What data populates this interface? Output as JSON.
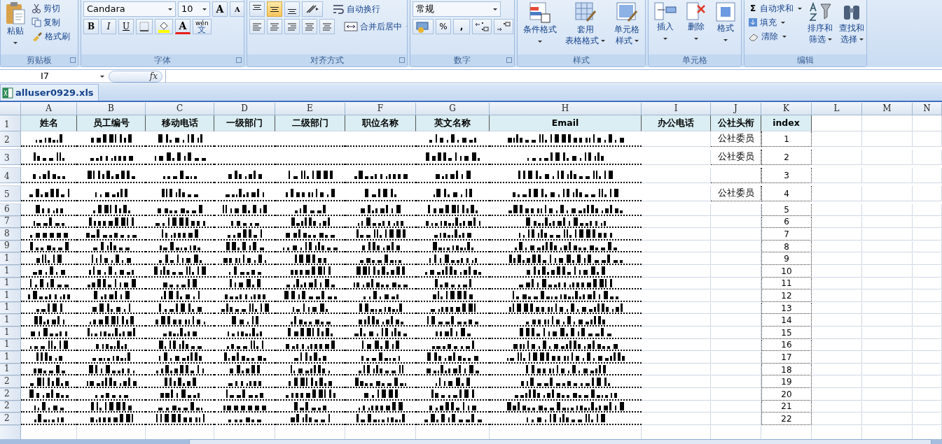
{
  "ribbon": {
    "groups": [
      {
        "kind": "clipboard",
        "label": "剪贴板",
        "big": "粘贴",
        "small": [
          "剪切",
          "复制",
          "格式刷"
        ]
      },
      {
        "kind": "font",
        "label": "字体",
        "font": "Candara",
        "size": "10",
        "grow": "A",
        "shrink": "A",
        "styles": [
          "B",
          "I",
          "U"
        ],
        "color_letter": "A",
        "phonetic_top": "wén",
        "phonetic_char": "文"
      },
      {
        "kind": "align",
        "label": "对齐方式",
        "valign": [
          {
            "selected": false
          },
          {
            "selected": true
          },
          {
            "selected": false
          }
        ],
        "wrap": "自动换行",
        "merge": "合并后居中"
      },
      {
        "kind": "number",
        "label": "数字",
        "format": "常规",
        "percent": "%",
        "comma": ","
      },
      {
        "kind": "large",
        "label": "样式",
        "buttons": [
          {
            "lines": [
              "条件格式"
            ]
          },
          {
            "lines": [
              "套用",
              "表格格式"
            ]
          },
          {
            "lines": [
              "单元格",
              "样式"
            ]
          }
        ]
      },
      {
        "kind": "large",
        "label": "单元格",
        "buttons": [
          {
            "lines": [
              "插入"
            ]
          },
          {
            "lines": [
              "删除"
            ]
          },
          {
            "lines": [
              "格式"
            ]
          }
        ]
      },
      {
        "kind": "editing",
        "label": "编辑",
        "sum_icon": "Σ",
        "small": [
          "自动求和",
          "填充",
          "清除"
        ],
        "buttons": [
          {
            "lines": [
              "排序和",
              "筛选"
            ]
          },
          {
            "lines": [
              "查找和",
              "选择"
            ]
          }
        ]
      }
    ]
  },
  "formula_bar": {
    "name_box": "I7",
    "fx": "fx"
  },
  "workbook": {
    "title": "alluser0929.xls"
  },
  "sheet": {
    "columns": [
      "A",
      "B",
      "C",
      "D",
      "E",
      "F",
      "G",
      "H",
      "I",
      "J",
      "K",
      "L",
      "M",
      "N"
    ],
    "header_row_label": "1",
    "headers": [
      "姓名",
      "员工编号",
      "移动电话",
      "一级部门",
      "二级部门",
      "职位名称",
      "英文名称",
      "Email",
      "办公电话",
      "公社头衔",
      "index"
    ],
    "rows": [
      {
        "row_label": "2",
        "title": "公社委员",
        "index": "1"
      },
      {
        "row_label": "3",
        "title": "公社委员",
        "index": "2"
      },
      {
        "row_label": "4",
        "index": "3"
      },
      {
        "row_label": "5",
        "title": "公社委员",
        "index": "4"
      },
      {
        "row_label": "6",
        "index": "5"
      },
      {
        "row_label": "7",
        "index": "6"
      },
      {
        "row_label": "8",
        "index": "7"
      },
      {
        "row_label": "9",
        "index": "8"
      },
      {
        "row_label": "1",
        "index": "9"
      },
      {
        "row_label": "1",
        "index": "10"
      },
      {
        "row_label": "1",
        "index": "11"
      },
      {
        "row_label": "1",
        "index": "12"
      },
      {
        "row_label": "1",
        "index": "13"
      },
      {
        "row_label": "1",
        "index": "14"
      },
      {
        "row_label": "1",
        "index": "15"
      },
      {
        "row_label": "1",
        "index": "16"
      },
      {
        "row_label": "1",
        "index": "17"
      },
      {
        "row_label": "1",
        "index": "18"
      },
      {
        "row_label": "2",
        "index": "19"
      },
      {
        "row_label": "2",
        "index": "20"
      },
      {
        "row_label": "2",
        "index": "21"
      },
      {
        "row_label": "2",
        "index": "22"
      }
    ]
  }
}
